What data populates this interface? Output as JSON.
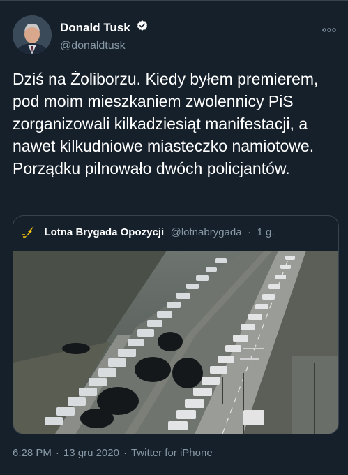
{
  "author": {
    "display_name": "Donald Tusk",
    "handle": "@donaldtusk",
    "verified": true,
    "more_icon": "more-horizontal-icon"
  },
  "tweet": {
    "text": "Dziś na Żoliborzu. Kiedy byłem premierem, pod moim mieszkaniem zwolennicy PiS zorganizowali kilkadziesiąt manifestacji, a nawet kilkudniowe miasteczko namiotowe. Porządku pilnowało dwóch policjantów."
  },
  "quoted_tweet": {
    "display_name": "Lotna Brygada Opozycji",
    "handle": "@lotnabrygada",
    "separator": "·",
    "time": "1 g.",
    "avatar_icon": "lightning-bolt-icon",
    "image": "aerial-street-police-vans"
  },
  "footer": {
    "time": "6:28 PM",
    "separator": "·",
    "date": "13 gru 2020",
    "source": "Twitter for iPhone"
  },
  "colors": {
    "background": "#15202b",
    "border": "#38444d",
    "secondary_text": "#8899a6",
    "verified_badge": "#ffffff"
  }
}
